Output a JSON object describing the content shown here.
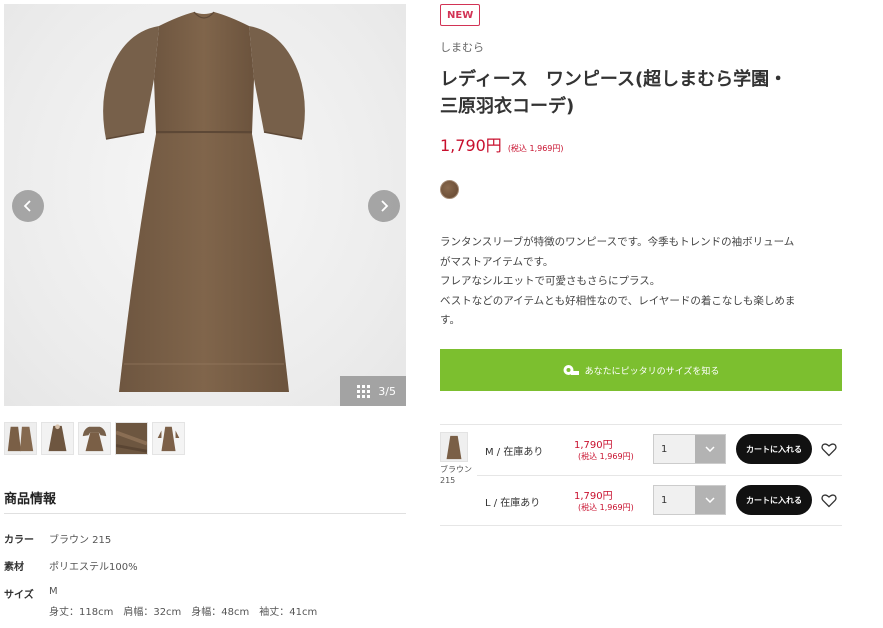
{
  "product": {
    "badge": "NEW",
    "brand": "しまむら",
    "title_line1": "レディース　ワンピース(超しまむら学園・",
    "title_line2": "三原羽衣コーデ)",
    "price": "1,790円",
    "price_tax": "(税込 1,969円)",
    "swatch_color": "#7a5a40",
    "description": [
      "ランタンスリーブが特徴のワンピースです。今季もトレンドの袖ボリューム",
      "がマストアイテムです。",
      "フレアなシルエットで可愛さもさらにプラス。",
      "ベストなどのアイテムとも好相性なので、レイヤードの着こなしも楽しめま",
      "す。"
    ],
    "size_finder_label": "あなたにピッタリのサイズを知る"
  },
  "gallery": {
    "counter": "3/5",
    "prev_icon": "chevron-left-icon",
    "next_icon": "chevron-right-icon",
    "thumbnail_count": 5
  },
  "spec": {
    "heading": "商品情報",
    "rows": [
      {
        "key": "カラー",
        "value": "ブラウン 215"
      },
      {
        "key": "素材",
        "value": "ポリエステル100%"
      },
      {
        "key": "サイズ",
        "value": "M"
      }
    ],
    "measurements": "身丈：118cm　肩幅：32cm　身幅：48cm　袖丈：41cm"
  },
  "sku": {
    "color_label": "ブラウン215",
    "rows": [
      {
        "size": "M / 在庫あり",
        "price": "1,790円",
        "tax": "(税込 1,969円)",
        "qty": "1",
        "cart": "カートに入れる"
      },
      {
        "size": "L / 在庫あり",
        "price": "1,790円",
        "tax": "(税込 1,969円)",
        "qty": "1",
        "cart": "カートに入れる"
      }
    ]
  },
  "colors": {
    "accent_red": "#c8102e",
    "size_button_green": "#7cbf2f",
    "cart_button": "#111111"
  }
}
